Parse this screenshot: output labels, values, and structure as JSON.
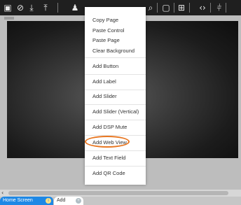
{
  "toolbar": {
    "icons": [
      "screen-icon",
      "no-entry-icon",
      "download-icon",
      "upload-icon",
      "person-icon",
      "search-icon",
      "tablet-icon",
      "grid-icon",
      "code-icon",
      "sliders-icon"
    ]
  },
  "context_menu": {
    "top_items": [
      "Copy Page",
      "Paste Control",
      "Paste Page",
      "Clear Background"
    ],
    "add_items": [
      "Add Button",
      "Add Label",
      "Add Slider",
      "Add Slider (Vertical)",
      "Add DSP Mute",
      "Add Web View",
      "Add Text Field",
      "Add QR Code"
    ],
    "highlighted_item": "Add Web View",
    "highlight_color": "#e87722"
  },
  "tabs": [
    {
      "label": "Home Screen",
      "icon": "info-icon",
      "active": true
    },
    {
      "label": "Add",
      "icon": "plus-icon",
      "active": false
    }
  ],
  "colors": {
    "toolbar_bg": "#1f1f1f",
    "active_tab": "#1e88e5"
  }
}
